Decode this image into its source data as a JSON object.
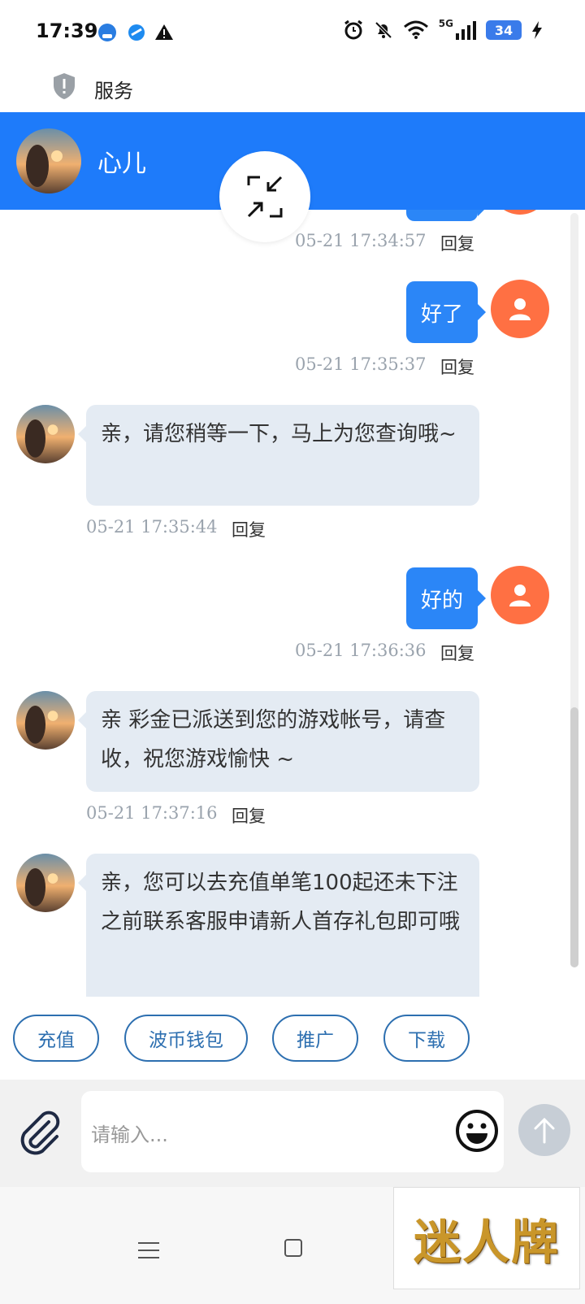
{
  "status_bar": {
    "time": "17:39",
    "network": "5G",
    "battery": "34"
  },
  "service": {
    "label": "服务"
  },
  "header": {
    "contact_name": "心儿"
  },
  "messages": [
    {
      "direction": "out",
      "text": "",
      "timestamp": "05-21 17:34:57",
      "reply": "回复"
    },
    {
      "direction": "out",
      "text": "好了",
      "timestamp": "05-21 17:35:37",
      "reply": "回复"
    },
    {
      "direction": "in",
      "text": "亲，请您稍等一下，马上为您查询哦~",
      "timestamp": "05-21 17:35:44",
      "reply": "回复"
    },
    {
      "direction": "out",
      "text": "好的",
      "timestamp": "05-21 17:36:36",
      "reply": "回复"
    },
    {
      "direction": "in",
      "text": "亲 彩金已派送到您的游戏帐号，请查收，祝您游戏愉快 ~",
      "timestamp": "05-21 17:37:16",
      "reply": "回复"
    },
    {
      "direction": "in",
      "text": "亲，您可以去充值单笔100起还未下注之前联系客服申请新人首存礼包即可哦",
      "timestamp": "",
      "reply": ""
    }
  ],
  "quick_actions": [
    "充值",
    "波币钱包",
    "推广",
    "下载"
  ],
  "input": {
    "placeholder": "请输入..."
  },
  "logo": {
    "text": "迷人牌"
  },
  "colors": {
    "header_blue": "#1e7bfa",
    "outgoing_bubble": "#2b86f7",
    "incoming_bubble": "#e4ebf3",
    "user_avatar": "#ff7043",
    "quick_button_border": "#2d6fb0"
  },
  "icons": [
    "shield-icon",
    "collapse-icon",
    "user-icon",
    "paperclip-icon",
    "emoji-icon",
    "arrow-up-icon",
    "menu-icon",
    "home-icon",
    "alarm-icon",
    "bell-off-icon",
    "wifi-icon",
    "signal-icon",
    "charging-icon"
  ]
}
